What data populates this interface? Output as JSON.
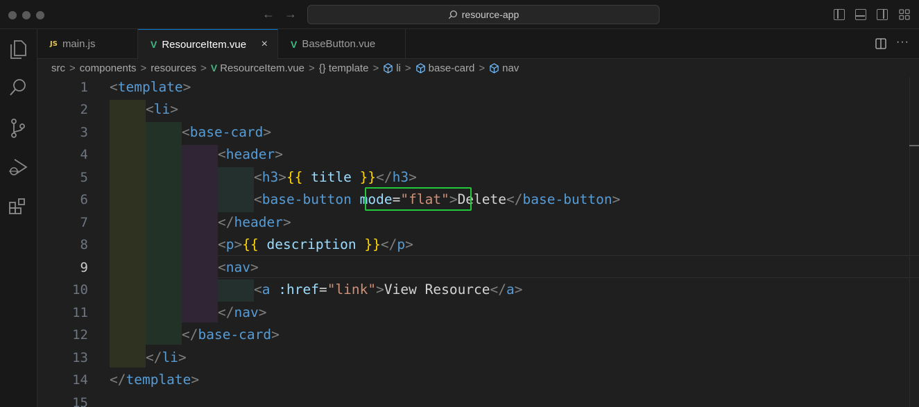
{
  "window": {
    "search_text": "resource-app"
  },
  "tabs": [
    {
      "badge": "JS",
      "label": "main.js",
      "active": false
    },
    {
      "badge": "V",
      "label": "ResourceItem.vue",
      "active": true,
      "close": "×"
    },
    {
      "badge": "V",
      "label": "BaseButton.vue",
      "active": false
    }
  ],
  "breadcrumb": {
    "parts": [
      "src",
      "components",
      "resources",
      "ResourceItem.vue",
      "{} template",
      "li",
      "base-card",
      "nav"
    ],
    "separator": ">"
  },
  "editor": {
    "current_line": 9,
    "line_numbers": [
      "1",
      "2",
      "3",
      "4",
      "5",
      "6",
      "7",
      "8",
      "9",
      "10",
      "11",
      "12",
      "13",
      "14",
      "15"
    ],
    "lines": [
      [
        "<",
        "template",
        ">"
      ],
      [
        "<",
        "li",
        ">"
      ],
      [
        "<",
        "base-card",
        ">"
      ],
      [
        "<",
        "header",
        ">"
      ],
      [
        "<",
        "h3",
        ">",
        "{{",
        " title ",
        "}}",
        "</",
        "h3",
        ">"
      ],
      [
        "<",
        "base-button",
        " ",
        "mode",
        "=",
        "\"flat\"",
        ">",
        "Delete",
        "</",
        "base-button",
        ">"
      ],
      [
        "</",
        "header",
        ">"
      ],
      [
        "<",
        "p",
        ">",
        "{{",
        " description ",
        "}}",
        "</",
        "p",
        ">"
      ],
      [
        "<",
        "nav",
        ">"
      ],
      [
        "<",
        "a",
        " ",
        ":href",
        "=",
        "\"link\"",
        ">",
        "View Resource",
        "</",
        "a",
        ">"
      ],
      [
        "</",
        "nav",
        ">"
      ],
      [
        "</",
        "base-card",
        ">"
      ],
      [
        "</",
        "li",
        ">"
      ],
      [
        "</",
        "template",
        ">"
      ],
      [
        ""
      ]
    ]
  },
  "colors": {
    "tag": "#569cd6",
    "bracket": "#808080",
    "mustache": "#ffd700",
    "attribute": "#9cdcfe",
    "string": "#ce9178",
    "highlight_box": "#22c93a",
    "indent_1": "#2f3121",
    "indent_2": "#223226",
    "indent_3": "#2f2535",
    "indent_4": "#23302d"
  },
  "icons": {
    "activity": [
      "files-icon",
      "search-icon",
      "source-control-icon",
      "run-debug-icon",
      "extensions-icon"
    ],
    "titlebar_right": [
      "toggle-sidebar-icon",
      "toggle-panel-icon",
      "toggle-secondary-sidebar-icon",
      "customize-layout-icon"
    ],
    "tabbar_right": [
      "split-editor-icon",
      "more-actions-icon"
    ]
  }
}
